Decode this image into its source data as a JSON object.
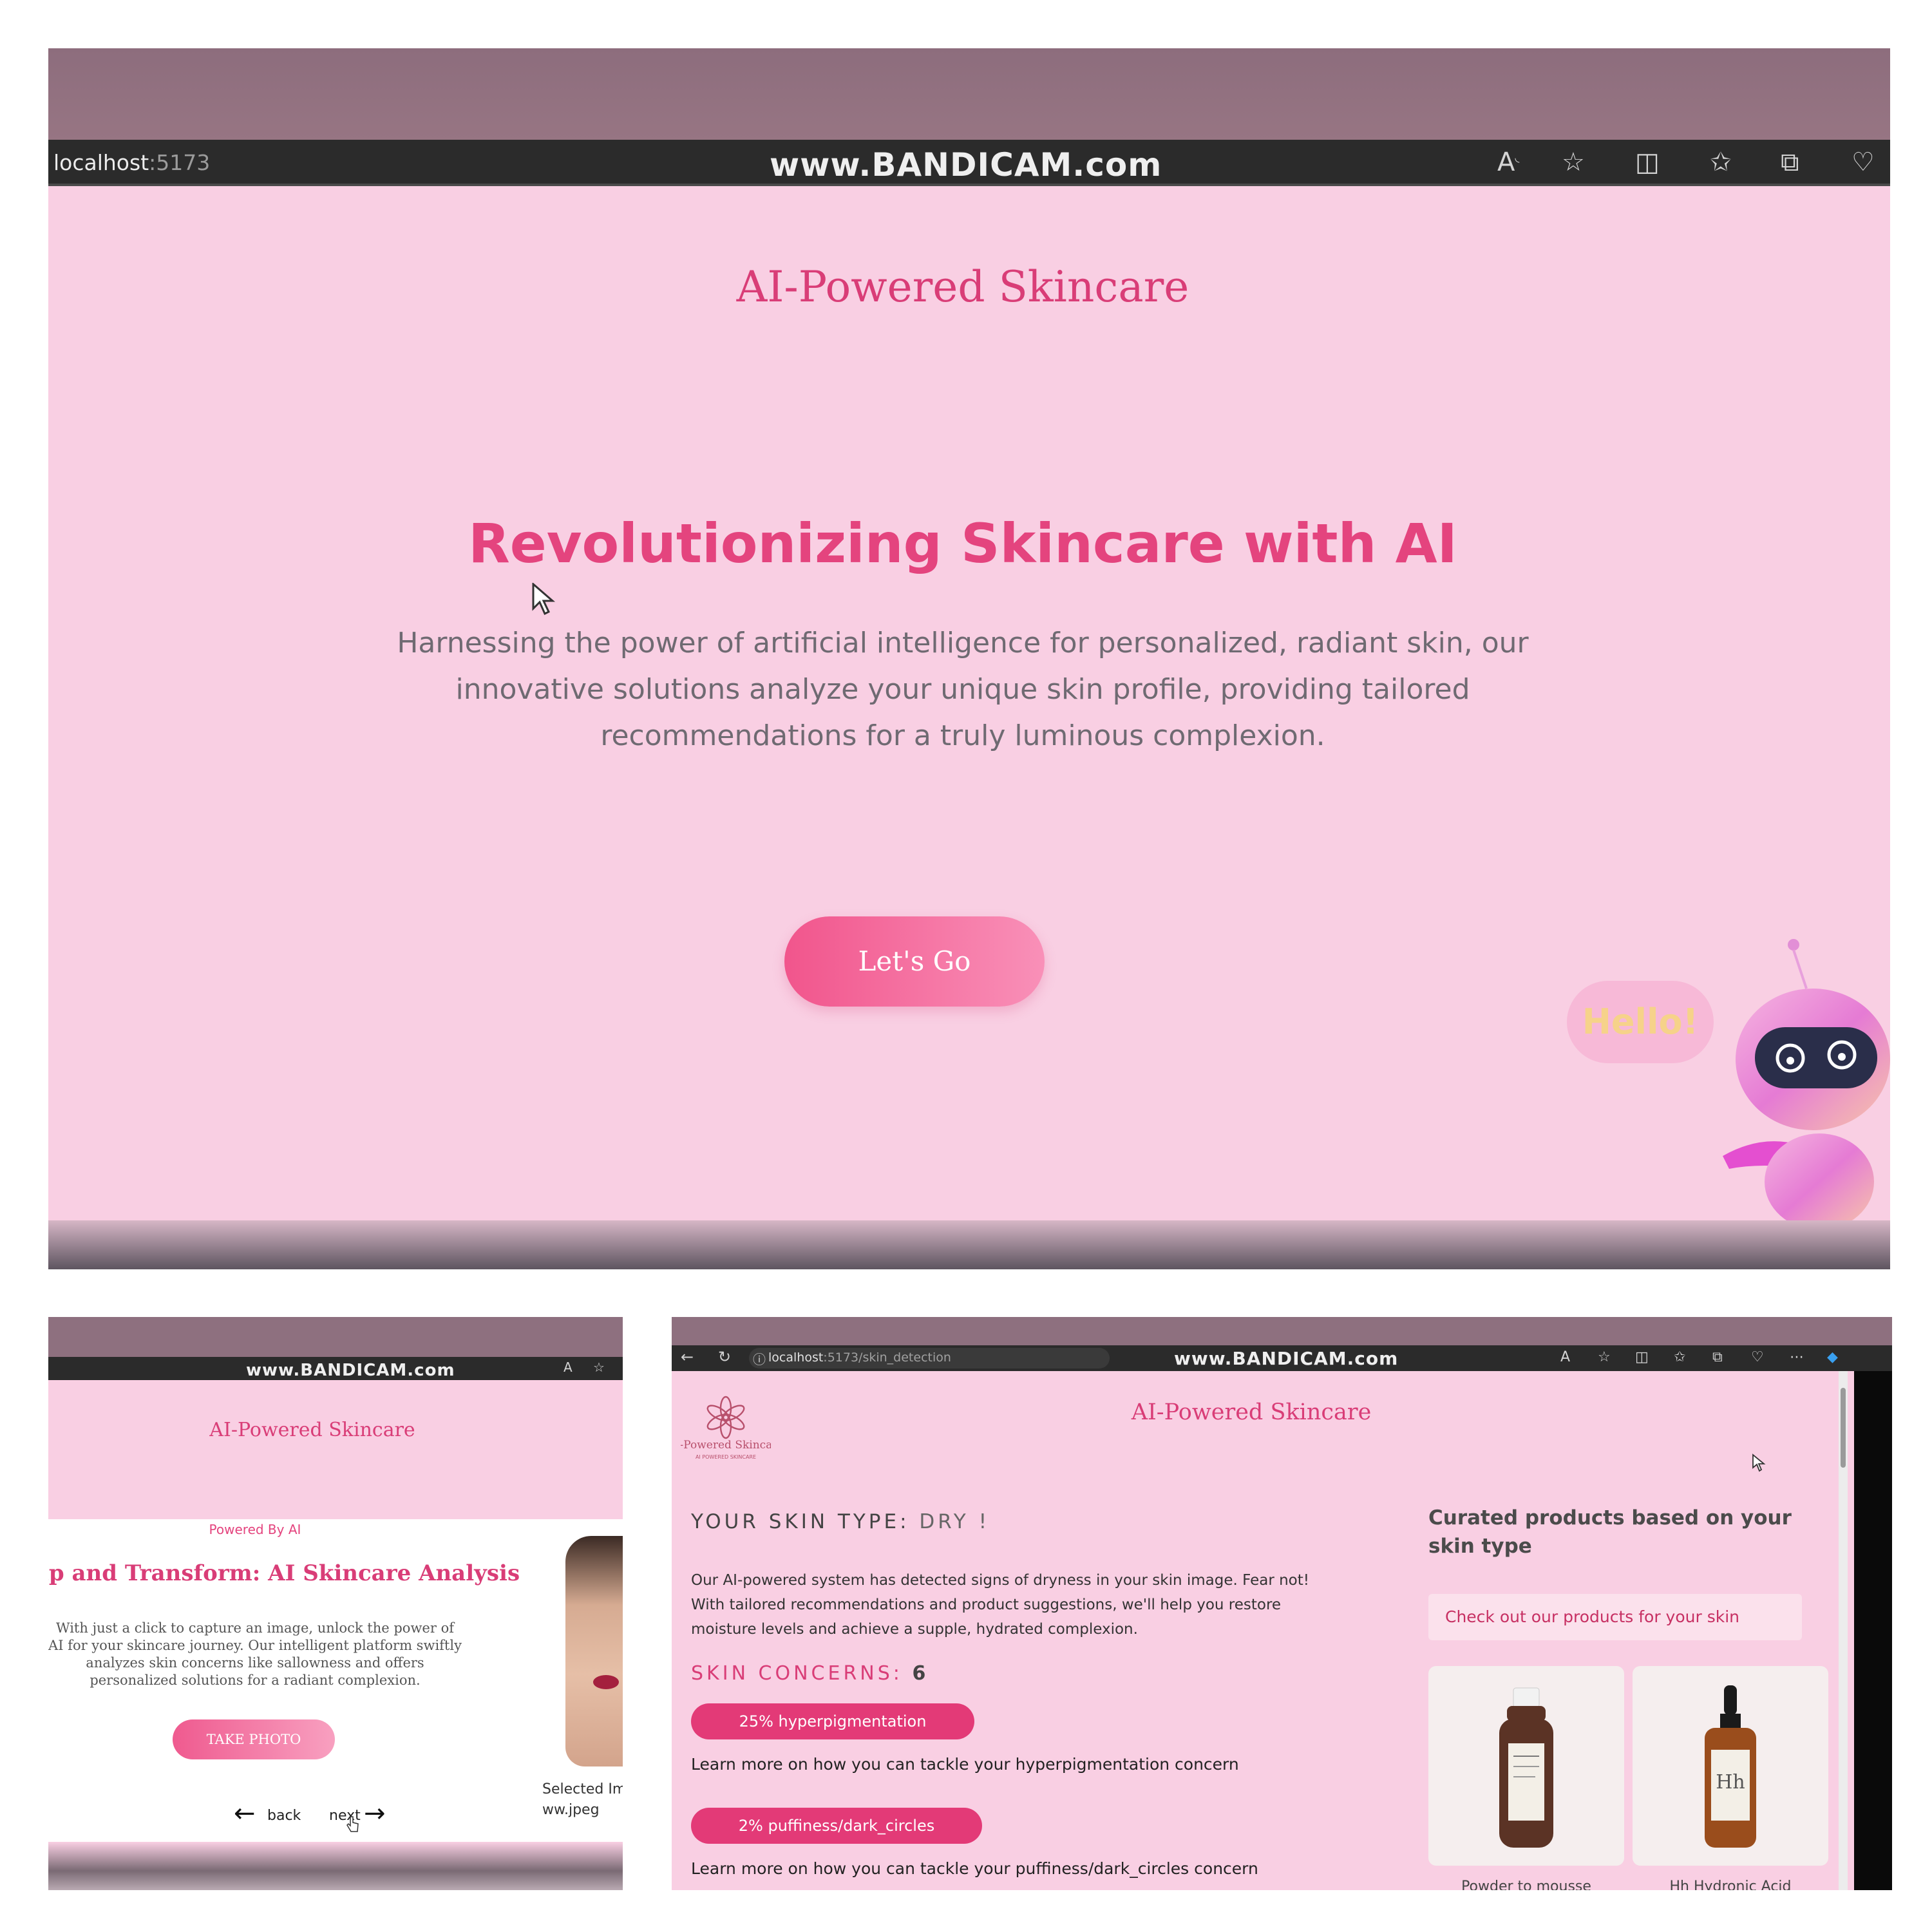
{
  "panelA": {
    "browser": {
      "url_host": "localhost",
      "url_port": ":5173",
      "watermark": "www.BANDICAM.com"
    },
    "brand": "AI-Powered Skincare",
    "hero_title": "Revolutionizing Skincare with AI",
    "hero_subtitle": "Harnessing the power of artificial intelligence for personalized, radiant skin, our innovative solutions analyze your unique skin profile, providing tailored recommendations for a truly luminous complexion.",
    "cta_label": "Let's Go",
    "mascot_bubble": "Hello!"
  },
  "panelB": {
    "browser": {
      "watermark": "www.BANDICAM.com"
    },
    "brand": "AI-Powered Skincare",
    "powered": "Powered By AI",
    "heading": "ıp and Transform: AI Skincare Analysis",
    "description": "With just a click to capture an image, unlock the power of AI for your skincare journey. Our intelligent platform swiftly analyzes skin concerns like sallowness and offers personalized solutions for a radiant complexion.",
    "take_photo_label": "TAKE PHOTO",
    "selected_line1": "Selected Ima",
    "selected_line2": "ww.jpeg",
    "back_label": "back",
    "next_label": "next"
  },
  "panelC": {
    "browser": {
      "url_host": "localhost",
      "url_rest": ":5173/skin_detection",
      "watermark": "www.BANDICAM.com"
    },
    "logo_text": "AI-Powered Skincare",
    "logo_subtext": "AI POWERED SKINCARE",
    "brand": "AI-Powered Skincare",
    "skin_type_label": "YOUR SKIN TYPE:",
    "skin_type_value": "DRY !",
    "skin_paragraph": "Our AI-powered system has detected signs of dryness in your skin image. Fear not! With tailored recommendations and product suggestions, we'll help you restore moisture levels and achieve a supple, hydrated complexion.",
    "concerns_label": "SKIN CONCERNS:",
    "concerns_count": "6",
    "concerns": [
      {
        "label": "25% hyperpigmentation",
        "learn": "Learn more on how you can tackle your hyperpigmentation concern"
      },
      {
        "label": "2% puffiness/dark_circles",
        "learn": "Learn more on how you can tackle your puffiness/dark_circles concern"
      }
    ],
    "curated_title": "Curated products based on your skin type",
    "checkout_label": "Check out our products for your skin",
    "products": [
      {
        "name": "Powder to mousse",
        "label_mark": ""
      },
      {
        "name": "Hh Hydronic Acid",
        "label_mark": "Hh"
      }
    ]
  },
  "colors": {
    "pink_bg": "#f9cfe3",
    "brand_pink": "#d93d77",
    "accent_pink": "#e33a77",
    "browser_bar": "#2b2b2b"
  }
}
